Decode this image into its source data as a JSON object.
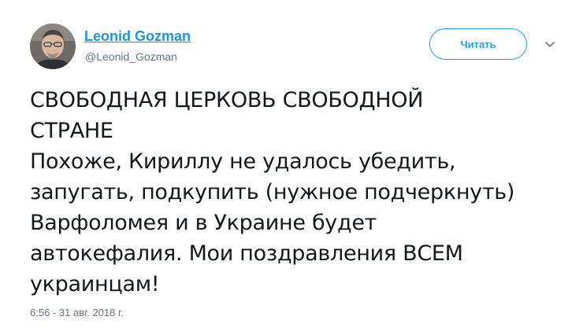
{
  "author": {
    "name": "Leonid Gozman",
    "handle": "@Leonid_Gozman"
  },
  "follow_button": {
    "label": "Читать"
  },
  "menu": {
    "icon": "chevron-down-icon"
  },
  "tweet": {
    "lines": [
      "СВОБОДНАЯ ЦЕРКОВЬ СВОБОДНОЙ",
      "СТРАНЕ",
      "Похоже, Кириллу не удалось убедить,",
      "запугать, подкупить (нужное подчеркнуть)",
      "Варфоломея и в Украине будет",
      "автокефалия. Мои поздравления ВСЕМ",
      "украинцам!"
    ],
    "timestamp": "6:56 - 31 авг. 2018 г."
  },
  "colors": {
    "link": "#1b95e0",
    "accent": "#1da1f2",
    "text": "#14171a",
    "muted": "#657786"
  }
}
